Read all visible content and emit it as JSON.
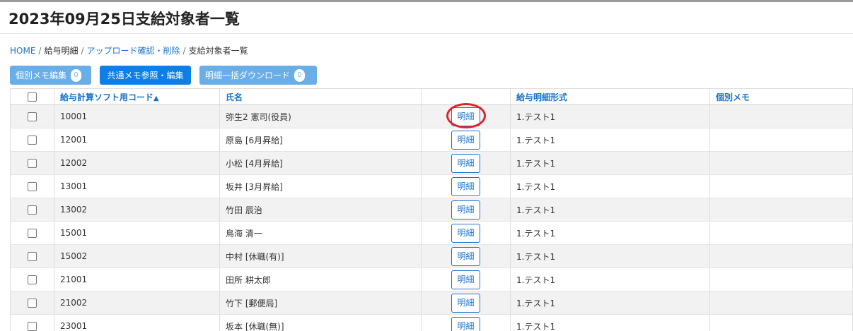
{
  "page": {
    "title": "2023年09月25日支給対象者一覧"
  },
  "breadcrumb": [
    {
      "label": "HOME"
    },
    {
      "label": "給与明細"
    },
    {
      "label": "アップロード確認・削除"
    },
    {
      "label": "支給対象者一覧"
    }
  ],
  "toolbar": {
    "memo_edit_label": "個別メモ編集",
    "memo_edit_count": "0",
    "common_memo_label": "共通メモ参照・編集",
    "bulk_download_label": "明細一括ダウンロード",
    "bulk_download_count": "0"
  },
  "table": {
    "headers": {
      "code": "給与計算ソフト用コード",
      "sort_indicator": "▲",
      "name": "氏名",
      "format": "給与明細形式",
      "memo": "個別メモ"
    },
    "detail_label": "明細",
    "rows": [
      {
        "code": "10001",
        "name": "弥生2 憲司(役員)",
        "format": "1.テスト1",
        "memo": ""
      },
      {
        "code": "12001",
        "name": "原島 [6月昇給]",
        "format": "1.テスト1",
        "memo": ""
      },
      {
        "code": "12002",
        "name": "小松 [4月昇給]",
        "format": "1.テスト1",
        "memo": ""
      },
      {
        "code": "13001",
        "name": "坂井 [3月昇給]",
        "format": "1.テスト1",
        "memo": ""
      },
      {
        "code": "13002",
        "name": "竹田 辰治",
        "format": "1.テスト1",
        "memo": ""
      },
      {
        "code": "15001",
        "name": "鳥海 清一",
        "format": "1.テスト1",
        "memo": ""
      },
      {
        "code": "15002",
        "name": "中村 [休職(有)]",
        "format": "1.テスト1",
        "memo": ""
      },
      {
        "code": "21001",
        "name": "田所 耕太郎",
        "format": "1.テスト1",
        "memo": ""
      },
      {
        "code": "21002",
        "name": "竹下 [郵便局]",
        "format": "1.テスト1",
        "memo": ""
      },
      {
        "code": "23001",
        "name": "坂本 [休職(無)]",
        "format": "1.テスト1",
        "memo": ""
      }
    ]
  },
  "annotation": {
    "highlight_color": "#e0232b"
  }
}
